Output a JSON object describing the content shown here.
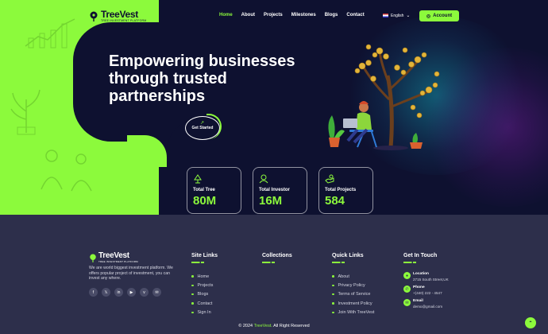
{
  "brand": {
    "name": "TreeVest",
    "tagline": "TREE INVESTMENT PLATFORM"
  },
  "nav": {
    "items": [
      {
        "label": "Home",
        "active": true
      },
      {
        "label": "About"
      },
      {
        "label": "Projects"
      },
      {
        "label": "Milestones"
      },
      {
        "label": "Blogs"
      },
      {
        "label": "Contact"
      }
    ],
    "language": "English",
    "account_label": "Account"
  },
  "hero": {
    "headline": "Empowering businesses through trusted partnerships",
    "cta_label": "Get Started"
  },
  "stats": [
    {
      "label": "Total Tree",
      "value": "80M",
      "icon": "tree-icon"
    },
    {
      "label": "Total Investor",
      "value": "16M",
      "icon": "investor-icon"
    },
    {
      "label": "Total Projects",
      "value": "584",
      "icon": "projects-icon"
    }
  ],
  "footer": {
    "about": "We are world biggest investment platform. We offers popular project of investment, you can invest any where.",
    "socials": [
      "f",
      "𝕏",
      "in",
      "▶",
      "v",
      "✉"
    ],
    "site_links": {
      "title": "Site Links",
      "items": [
        "Home",
        "Projects",
        "Blogs",
        "Contact",
        "Sign In"
      ]
    },
    "collections": {
      "title": "Collections"
    },
    "quick_links": {
      "title": "Quick Links",
      "items": [
        "About",
        "Privacy Policy",
        "Terms of Service",
        "Investment Policy",
        "Join With TreeVest"
      ]
    },
    "get_in_touch": {
      "title": "Get In Touch",
      "location": {
        "title": "Location",
        "value": "2715 South Street,UK"
      },
      "phone": {
        "title": "Phone",
        "value": "+(440) 222 - 4547"
      },
      "email": {
        "title": "Email",
        "value": "demo@gmail.com"
      }
    },
    "copyright_prefix": "© 2024",
    "copyright_brand": "TreeVest.",
    "copyright_suffix": "All Right Reserved"
  },
  "colors": {
    "accent": "#8cfa3c",
    "dark": "#0e1130",
    "footer_bg": "#2d2f4b"
  }
}
